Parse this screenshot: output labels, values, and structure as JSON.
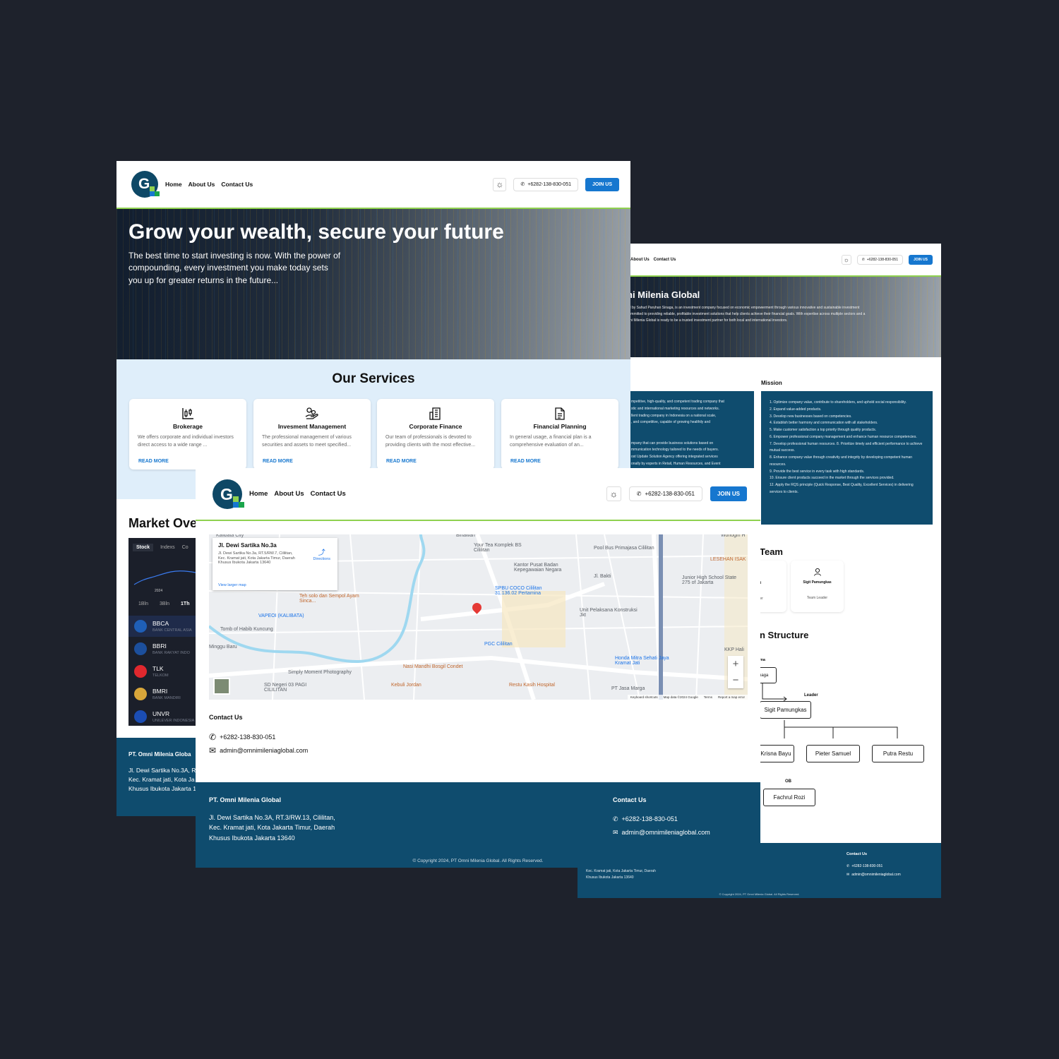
{
  "brand": {
    "accent": "#1677cf",
    "footer_bg": "#0f4c6e",
    "line": "#8fd14f",
    "bg": "#1e222c"
  },
  "nav": {
    "links": [
      "Home",
      "About Us",
      "Contact Us"
    ],
    "phone": "+6282-138-830-051",
    "join": "JOIN US",
    "theme_icon": "sun-icon"
  },
  "home": {
    "hero_title": "Grow your wealth, secure your future",
    "hero_text": "The best time to start investing is now. With the power of compounding, every investment you make today sets you up for greater returns in the future...",
    "services_title": "Our Services",
    "services": [
      {
        "title": "Brokerage",
        "text": "We offers corporate and individual investors direct access to a wide range ...",
        "more": "READ MORE",
        "icon": "chart-candles-icon"
      },
      {
        "title": "Invesment Management",
        "text": "The professional management of various securities and assets to meet specified...",
        "more": "READ MORE",
        "icon": "hand-coins-icon"
      },
      {
        "title": "Corporate Finance",
        "text": "Our team of professionals is devoted to providing clients with the most effective...",
        "more": "READ MORE",
        "icon": "building-icon"
      },
      {
        "title": "Financial Planning",
        "text": "In general usage, a financial plan is a comprehensive evaluation of an...",
        "more": "READ MORE",
        "icon": "document-icon"
      }
    ],
    "market_title": "Market Ove",
    "market_tabs": [
      "Stock",
      "Indexs",
      "Co"
    ],
    "chart_year": "2024",
    "ranges": [
      "1Bln",
      "3Bln",
      "1Th"
    ],
    "stocks": [
      {
        "ticker": "BBCA",
        "name": "BANK CENTRAL ASIA",
        "color": "#1f5fb7"
      },
      {
        "ticker": "BBRI",
        "name": "BANK RAKYAT INDO",
        "color": "#1c4f9c"
      },
      {
        "ticker": "TLK",
        "name": "TELKOM",
        "color": "#e0282e"
      },
      {
        "ticker": "BMRI",
        "name": "BANK MANDIRI",
        "color": "#d8a63a"
      },
      {
        "ticker": "UNVR",
        "name": "UNILEVER INDONESIA",
        "color": "#1b4db3"
      }
    ],
    "footer_company": "PT. Omni Milenia Globa",
    "footer_address": [
      "Jl. Dewi Sartika No.3A, R",
      "Kec. Kramat jati, Kota Ja",
      "Khusus Ibukota Jakarta 1"
    ]
  },
  "about": {
    "title": "ni Milenia Global",
    "intro": [
      "ed by Sahud Paruhan Sinaga, is an investment company focused on economic empowerment through various innovative and sustainable investment",
      "committed to providing reliable, profitable investment solutions that help clients achieve their financial goals. With expertise across multiple sectors and a",
      "mni Milenia Global is ready to be a trusted investment partner for both local and international investors."
    ],
    "vision_lines": [
      "mpetitive, high-quality, and competent trading company that",
      "stic and international marketing resources and networks.",
      "llent trading company in Indonesia on a national scale,",
      ", and competitive, capable of growing healthily and",
      "",
      "",
      "mpany that can provide business solutions based on",
      "mmunication technology tailored to the needs of buyers.",
      "ost Update Solution Agency offering integrated services",
      "onally by experts in Retail, Human Resources, and Event",
      "ng to help clients succeed in expanding their brand exposure"
    ],
    "mission_title": "Mission",
    "mission": [
      "1. Optimize company value, contribute to shareholders, and uphold social responsibility.",
      "2. Expand value-added products.",
      "3. Develop new businesses based on competencies.",
      "4. Establish better harmony and communication with all stakeholders.",
      "5. Make customer satisfaction a top priority through quality products.",
      "6. Empower professional company management and enhance human resource competencies.",
      "7. Develop professional human resources. 8. Prioritize timely and efficient performance to achieve mutual success.",
      "8. Enhance company value through creativity and integrity by developing competent human resources.",
      "9. Provide the best service in every task with high standards.",
      "10. Ensure client products succeed in the market through the services provided.",
      "12. Apply the RQS principle (Quick Response, Best Quality, Excellent Services) in delivering services to clients."
    ],
    "team_title": "Team",
    "team": [
      {
        "name": "Wati",
        "role": "Leader"
      },
      {
        "name": "Sigit Pamungkas",
        "role": "Team Leader"
      }
    ],
    "structure_title": "n Structure",
    "org": {
      "top_label": "ma",
      "top": "Sinaga",
      "leader_label": "Leader",
      "leader": "Sigit Pamungkas",
      "members": [
        "Krisna Bayu",
        "Pieter Samuel",
        "Putra Restu"
      ],
      "ob_label": "OB",
      "ob": "Fachrul Rozi"
    },
    "footer_address": [
      "Kec. Kramat jati, Kota Jakarta Timur, Daerah",
      "Khusus Ibukota Jakarta 13640"
    ],
    "footer_contact_title": "Contact Us",
    "phone": "+6282-138-830-051",
    "email": "admin@omnimileniaglobal.com",
    "copyright": "© Copyright 2024, PT Omni Milenia Global. All Rights Reserved."
  },
  "contact": {
    "map": {
      "place_title": "Jl. Dewi Sartika No.3a",
      "place_address": "Jl. Dewi Sartika No.3a, RT.5/RW.7, Cililitan, Kec. Kramat jati, Kota Jakarta Timur, Daerah Khusus Ibukota Jakarta 13640",
      "directions": "Directions",
      "larger_map": "View larger map",
      "labels": [
        "Kalibata City",
        "Binawan",
        "Your Tea Komplek BS Cililitan",
        "Pool Bus Primajasa Cililitan",
        "Kantor Pusat Badan Kepegawaian Negara",
        "Jl. Bakti",
        "Junior High School State 275 of Jakarta",
        "SPBU COCO Cililitan 31.136.02 Pertamina",
        "Teh solo dan Sempol Ayam Sinca...",
        "VAPEOI (KALIBATA)",
        "Tomb of Habib Kuncung",
        "Minggu Baru",
        "PGC Cililitan",
        "Unit Pelaksana Konstruksi Jkt",
        "Honda Mitra Sehati Jaya Kramat Jati",
        "Nasi Mandhi Bosgil Condet",
        "Simply Moment Photography",
        "SD Negeri 03 PAGI CILILITAN",
        "Kebuli Jordan",
        "Restu Kasih Hospital",
        "PT Jasa Marga",
        "LESEHAN ISAK",
        "Wonogiri H",
        "KKP Hali"
      ],
      "attribution": [
        "Keyboard shortcuts",
        "Map data ©2024 Google",
        "Terms",
        "Report a map error"
      ],
      "zoom_in": "+",
      "zoom_out": "−"
    },
    "title": "Contact Us",
    "phone": "+6282-138-830-051",
    "email": "admin@omnimileniaglobal.com",
    "footer_company": "PT. Omni Milenia Global",
    "footer_address": [
      "Jl. Dewi Sartika No.3A, RT.3/RW.13, Cililitan,",
      "Kec. Kramat jati, Kota Jakarta Timur, Daerah",
      "Khusus Ibukota Jakarta 13640"
    ],
    "footer_contact_title": "Contact Us",
    "copyright": "© Copyright 2024, PT Omni Milenia Global. All Rights Reserved."
  }
}
